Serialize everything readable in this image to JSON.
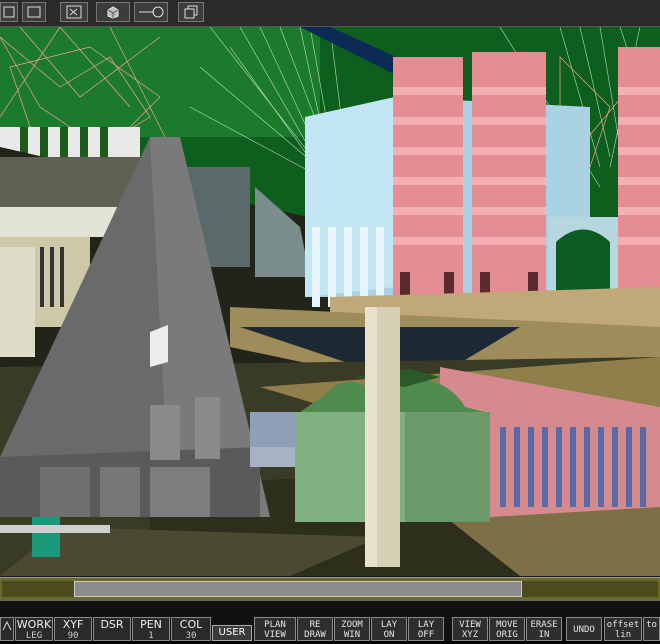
{
  "toolbar": {
    "buttons": [
      {
        "icon": "square-icon"
      },
      {
        "icon": "rectangle-icon"
      },
      {
        "icon": "select-region-icon"
      },
      {
        "icon": "cube-icon"
      },
      {
        "icon": "lens-icon"
      },
      {
        "icon": "copy-window-icon"
      }
    ]
  },
  "viewport": {
    "description": "3D perspective view of architectural model"
  },
  "bottombar": {
    "fields": [
      {
        "label": "WORK",
        "value": "LEG"
      },
      {
        "label": "XYF",
        "value": "90"
      },
      {
        "label": "DSR",
        "value": ""
      },
      {
        "label": "PEN",
        "value": "1"
      },
      {
        "label": "COL",
        "value": "30"
      }
    ],
    "user_label": "USER",
    "commands": [
      {
        "line1": "PLAN",
        "line2": "VIEW"
      },
      {
        "line1": "RE",
        "line2": "DRAW"
      },
      {
        "line1": "ZOOM",
        "line2": "WIN"
      },
      {
        "line1": "LAY",
        "line2": "ON"
      },
      {
        "line1": "LAY",
        "line2": "OFF"
      },
      {
        "line1": "VIEW",
        "line2": "XYZ"
      },
      {
        "line1": "MOVE",
        "line2": "ORIG"
      },
      {
        "line1": "ERASE",
        "line2": "IN"
      },
      {
        "line1": "UNDO",
        "line2": ""
      },
      {
        "line1": "offset",
        "line2": "lin"
      },
      {
        "line1": "to",
        "line2": ""
      }
    ]
  }
}
